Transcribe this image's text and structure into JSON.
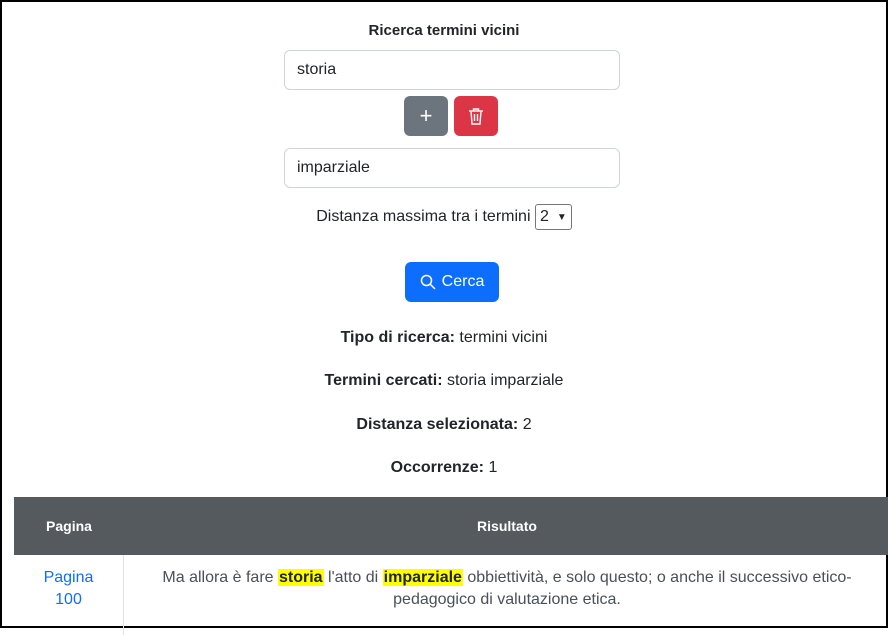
{
  "title": "Ricerca termini vicini",
  "term1": "storia",
  "term2": "imparziale",
  "buttons": {
    "add": "+",
    "search": "Cerca"
  },
  "distance": {
    "label": "Distanza massima tra i termini",
    "value": "2"
  },
  "info": {
    "tipo_label": "Tipo di ricerca:",
    "tipo_value": "termini vicini",
    "termini_label": "Termini cercati:",
    "termini_value": "storia imparziale",
    "distanza_label": "Distanza selezionata:",
    "distanza_value": "2",
    "occorrenze_label": "Occorrenze:",
    "occorrenze_value": "1"
  },
  "table": {
    "headers": [
      "Pagina",
      "Risultato"
    ],
    "rows": [
      {
        "page_line1": "Pagina",
        "page_line2": "100",
        "result_before": "Ma allora è fare ",
        "highlight1": "storia",
        "result_mid": " l'atto di ",
        "highlight2": "imparziale",
        "result_after": " obbiettività, e solo questo; o anche il successivo etico-pedagogico di valutazione etica."
      }
    ]
  },
  "colors": {
    "primary": "#0d6efd",
    "secondary": "#6c757d",
    "danger": "#dc3545",
    "header": "#555a5f",
    "highlight": "#ffff00"
  },
  "icons": [
    "plus-icon",
    "trash-icon",
    "search-icon",
    "chevron-down-icon"
  ]
}
